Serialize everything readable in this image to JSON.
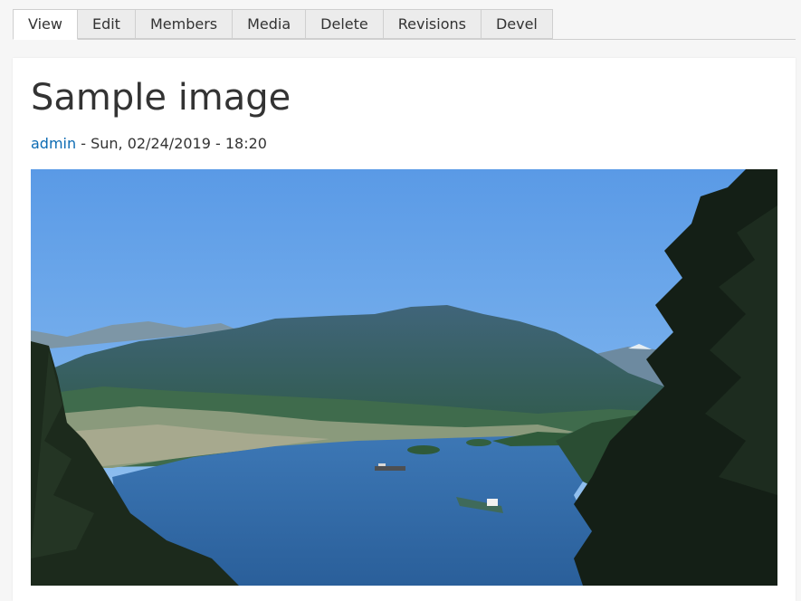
{
  "tabs": [
    {
      "label": "View",
      "active": true
    },
    {
      "label": "Edit",
      "active": false
    },
    {
      "label": "Members",
      "active": false
    },
    {
      "label": "Media",
      "active": false
    },
    {
      "label": "Delete",
      "active": false
    },
    {
      "label": "Revisions",
      "active": false
    },
    {
      "label": "Devel",
      "active": false
    }
  ],
  "node": {
    "title": "Sample image",
    "author": "admin",
    "date": " - Sun, 02/24/2019 - 18:20"
  },
  "colors": {
    "link": "#0c6bb3",
    "active_tab_bg": "#ffffff",
    "tab_bg": "#ececec",
    "page_bg": "#f6f6f6"
  }
}
